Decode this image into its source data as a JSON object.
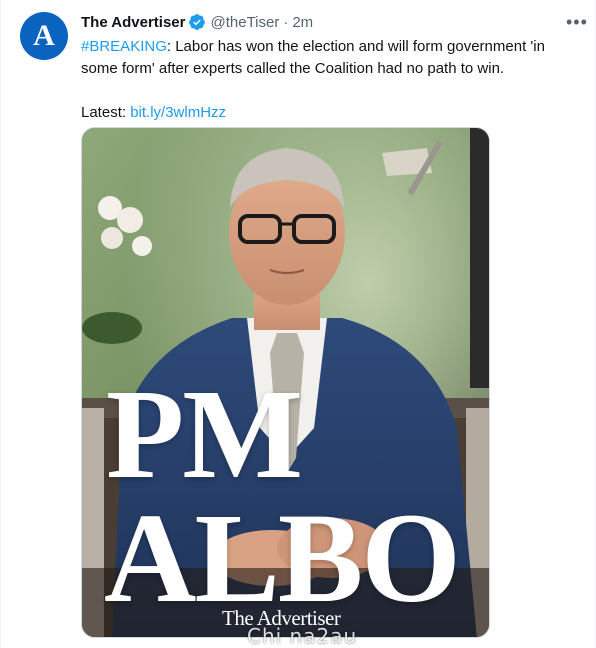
{
  "tweet": {
    "avatar_letter": "A",
    "author_name": "The Advertiser",
    "handle": "@theTiser",
    "separator": "·",
    "time": "2m",
    "more_label": "•••",
    "hashtag": "#BREAKING",
    "body": ": Labor has won the election and will form government 'in some form' after experts called the Coalition had no path to win.",
    "latest_label": "Latest: ",
    "link_text": "bit.ly/3wlmHzz"
  },
  "media": {
    "headline_line1": "PM",
    "headline_line2": "ALBO",
    "brand_logo": "The Advertiser"
  },
  "watermark": "Chi na2au",
  "colors": {
    "accent": "#1d9bf0",
    "avatar_bg": "#0a63bf",
    "secondary_text": "#536471"
  }
}
